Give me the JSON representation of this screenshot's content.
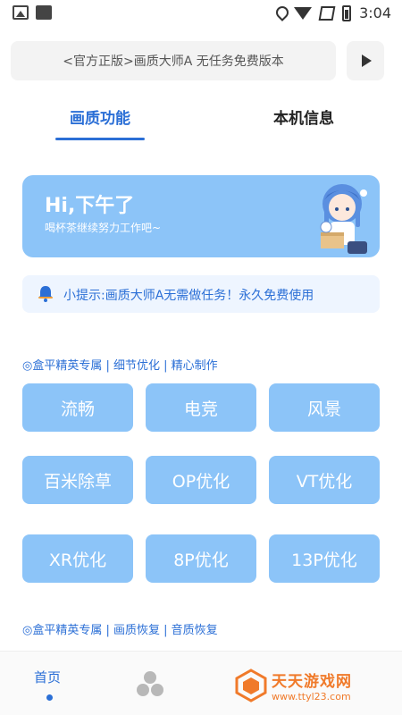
{
  "status_bar": {
    "time": "3:04"
  },
  "top_bar": {
    "title": "<官方正版>画质大师A 无任务免费版本"
  },
  "tabs": [
    {
      "label": "画质功能",
      "active": true
    },
    {
      "label": "本机信息",
      "active": false
    }
  ],
  "hero": {
    "title": "Hi,下午了",
    "subtitle": "喝杯茶继续努力工作吧~"
  },
  "tip": {
    "text": "小提示:画质大师A无需做任务！永久免费使用"
  },
  "sections": [
    {
      "heading": "◎盒平精英专属 | 细节优化 | 精心制作",
      "buttons": [
        "流畅",
        "电竞",
        "风景",
        "百米除草",
        "OP优化",
        "VT优化",
        "XR优化",
        "8P优化",
        "13P优化"
      ]
    },
    {
      "heading": "◎盒平精英专属 | 画质恢复 | 音质恢复"
    }
  ],
  "bottom_nav": {
    "home_label": "首页"
  },
  "watermark": {
    "title": "天天游戏网",
    "url": "www.ttyl23.com"
  },
  "colors": {
    "accent": "#2b6fd6",
    "button_bg": "#8cc4f8",
    "tip_bg": "#eef5ff",
    "watermark": "#f07a2a"
  }
}
